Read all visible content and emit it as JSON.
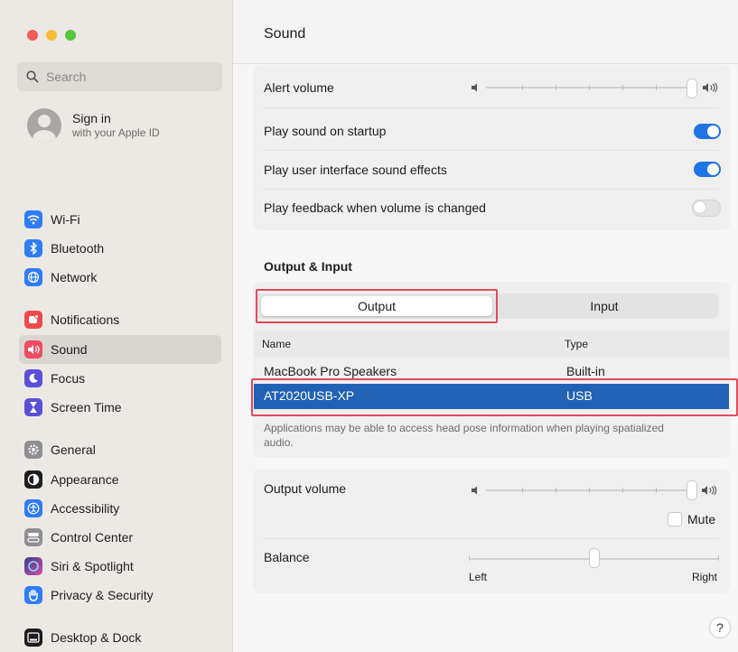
{
  "window": {
    "title": "Sound",
    "traffic_lights": [
      "#f05c57",
      "#f7bd3a",
      "#56c43f"
    ]
  },
  "sidebar": {
    "search_placeholder": "Search",
    "account": {
      "title": "Sign in",
      "subtitle": "with your Apple ID"
    },
    "items": [
      {
        "label": "Wi-Fi",
        "icon": "wifi-icon",
        "color": "#2f7cf5"
      },
      {
        "label": "Bluetooth",
        "icon": "bluetooth-icon",
        "color": "#2f7cf5"
      },
      {
        "label": "Network",
        "icon": "globe-icon",
        "color": "#2f7cf5"
      },
      {
        "label": "Notifications",
        "icon": "bell-icon",
        "color": "#ef4b4b"
      },
      {
        "label": "Sound",
        "icon": "speaker-icon",
        "color": "#ef4b61"
      },
      {
        "label": "Focus",
        "icon": "moon-icon",
        "color": "#5a4fd6"
      },
      {
        "label": "Screen Time",
        "icon": "hourglass-icon",
        "color": "#5a4fd6"
      },
      {
        "label": "General",
        "icon": "gear-icon",
        "color": "#8e8e93"
      },
      {
        "label": "Appearance",
        "icon": "appearance-icon",
        "color": "#1d1d1f"
      },
      {
        "label": "Accessibility",
        "icon": "accessibility-icon",
        "color": "#2f7cf5"
      },
      {
        "label": "Control Center",
        "icon": "control-center-icon",
        "color": "#8e8e93"
      },
      {
        "label": "Siri & Spotlight",
        "icon": "siri-icon",
        "color": "#7a3fd0"
      },
      {
        "label": "Privacy & Security",
        "icon": "hand-icon",
        "color": "#2f7cf5"
      },
      {
        "label": "Desktop & Dock",
        "icon": "dock-icon",
        "color": "#1d1d1f"
      }
    ]
  },
  "sound_effects": {
    "alert_volume_label": "Alert volume",
    "alert_volume_level": 1.0,
    "startup_label": "Play sound on startup",
    "startup_on": true,
    "ui_effects_label": "Play user interface sound effects",
    "ui_effects_on": true,
    "feedback_label": "Play feedback when volume is changed",
    "feedback_on": false
  },
  "output_input": {
    "section_title": "Output & Input",
    "tabs": [
      "Output",
      "Input"
    ],
    "selected_tab": "Output",
    "columns": [
      "Name",
      "Type"
    ],
    "devices": [
      {
        "name": "MacBook Pro Speakers",
        "type": "Built-in",
        "selected": false
      },
      {
        "name": "AT2020USB-XP",
        "type": "USB",
        "selected": true
      }
    ],
    "note": "Applications may be able to access head pose information when playing spatialized audio."
  },
  "output": {
    "volume_label": "Output volume",
    "volume_level": 1.0,
    "mute_label": "Mute",
    "mute_checked": false,
    "balance_label": "Balance",
    "balance_value": 0.5,
    "balance_left": "Left",
    "balance_right": "Right"
  },
  "help_label": "?"
}
